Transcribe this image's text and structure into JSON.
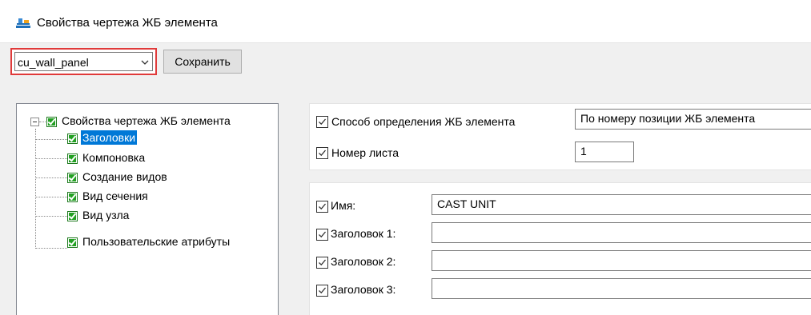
{
  "window": {
    "title": "Свойства чертежа ЖБ элемента",
    "icon": "drawing-properties-icon"
  },
  "toolbar": {
    "preset_value": "cu_wall_panel",
    "save_label": "Сохранить"
  },
  "tree": {
    "root_label": "Свойства чертежа ЖБ элемента",
    "items": [
      {
        "label": "Заголовки",
        "selected": true
      },
      {
        "label": "Компоновка",
        "selected": false
      },
      {
        "label": "Создание видов",
        "selected": false
      },
      {
        "label": "Вид сечения",
        "selected": false
      },
      {
        "label": "Вид узла",
        "selected": false
      },
      {
        "label": "Пользовательские атрибуты",
        "selected": false
      }
    ]
  },
  "settings": {
    "method_label": "Способ определения ЖБ элемента",
    "method_value": "По номеру позиции ЖБ элемента",
    "sheet_label": "Номер листа",
    "sheet_value": "1"
  },
  "titles": {
    "name_label": "Имя:",
    "name_value": "CAST UNIT",
    "title1_label": "Заголовок 1:",
    "title1_value": "",
    "title2_label": "Заголовок 2:",
    "title2_value": "",
    "title3_label": "Заголовок 3:",
    "title3_value": ""
  },
  "colors": {
    "highlight_border": "#e03a3a",
    "selection": "#0078d7",
    "checkbox_green": "#22a022"
  }
}
